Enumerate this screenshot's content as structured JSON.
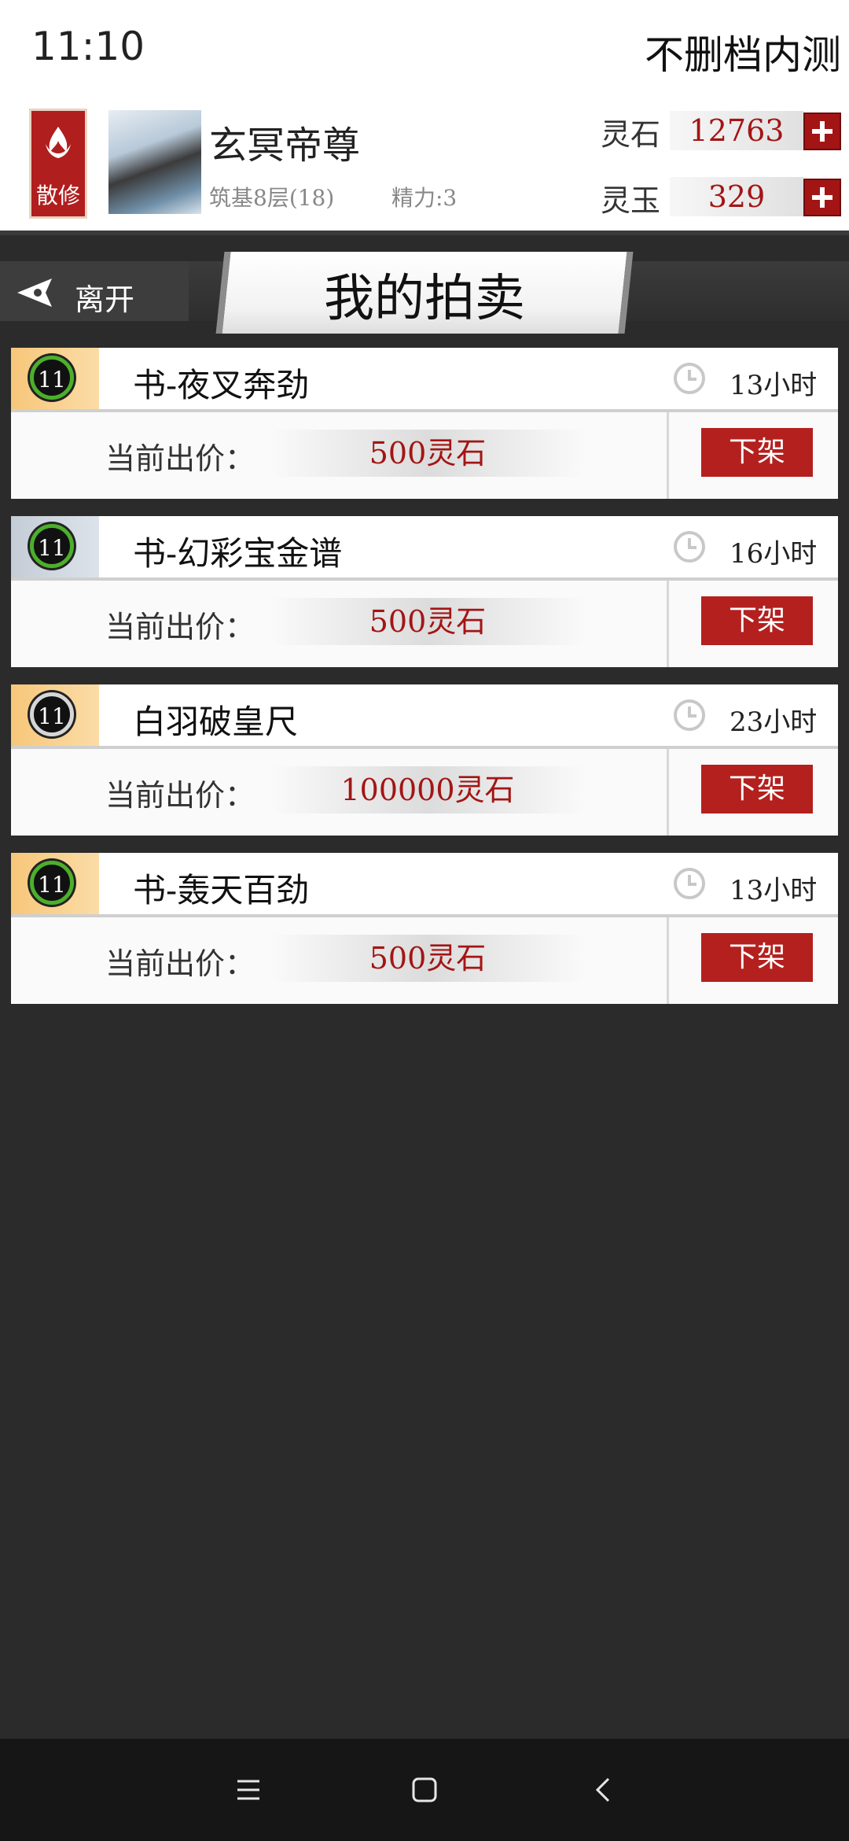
{
  "status_bar": {
    "time": "11:10",
    "label": "不删档内测"
  },
  "profile": {
    "sect": "散修",
    "name": "玄冥帝尊",
    "realm": "筑基8层(18)",
    "energy": "精力:3"
  },
  "currencies": [
    {
      "label": "灵石",
      "value": "12763"
    },
    {
      "label": "灵玉",
      "value": "329"
    }
  ],
  "title_bar": {
    "leave_label": "离开",
    "title": "我的拍卖"
  },
  "auctions": [
    {
      "level": "11",
      "name": "书-夜叉奔劲",
      "time": "13小时",
      "bid_label": "当前出价：",
      "bid": "500灵石",
      "delist_label": "下架"
    },
    {
      "level": "11",
      "name": "书-幻彩宝金谱",
      "time": "16小时",
      "bid_label": "当前出价：",
      "bid": "500灵石",
      "delist_label": "下架"
    },
    {
      "level": "11",
      "name": "白羽破皇尺",
      "time": "23小时",
      "bid_label": "当前出价：",
      "bid": "100000灵石",
      "delist_label": "下架"
    },
    {
      "level": "11",
      "name": "书-轰天百劲",
      "time": "13小时",
      "bid_label": "当前出价：",
      "bid": "500灵石",
      "delist_label": "下架"
    }
  ],
  "colors": {
    "accent_red": "#b3201e",
    "price_red": "#a31515",
    "background": "#2b2b2b"
  },
  "icons": [
    "sect-emblem-icon",
    "plus-icon",
    "leave-arrow-icon",
    "clock-icon",
    "menu-icon",
    "home-icon",
    "back-icon"
  ]
}
